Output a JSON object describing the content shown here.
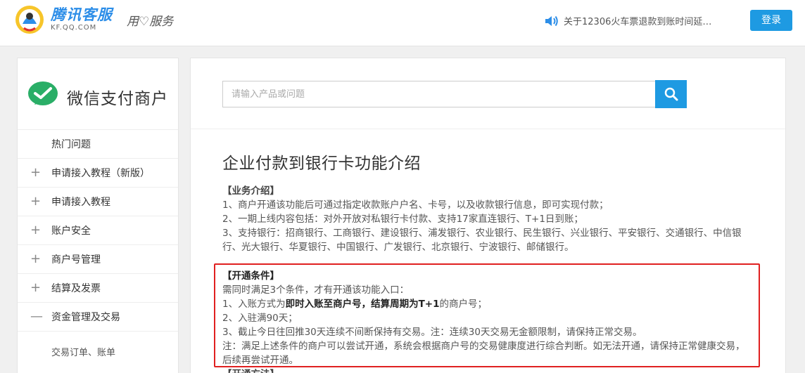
{
  "header": {
    "brand_cn": "腾讯客服",
    "brand_url": "KF.QQ.COM",
    "slogan": "用♡服务",
    "notice": "关于12306火车票退款到账时间延…",
    "login_label": "登录"
  },
  "sidebar": {
    "title": "微信支付商户",
    "items": [
      {
        "label": "热门问题",
        "icon": ""
      },
      {
        "label": "申请接入教程（新版）",
        "icon": "+"
      },
      {
        "label": "申请接入教程",
        "icon": "+"
      },
      {
        "label": "账户安全",
        "icon": "+"
      },
      {
        "label": "商户号管理",
        "icon": "+"
      },
      {
        "label": "结算及发票",
        "icon": "+"
      },
      {
        "label": "资金管理及交易",
        "icon": "—"
      }
    ],
    "sub_items": [
      "交易订单、账单"
    ]
  },
  "search": {
    "placeholder": "请输入产品或问题"
  },
  "article": {
    "title": "企业付款到银行卡功能介绍",
    "s1_heading": "【业务介绍】",
    "s1_lines": [
      "1、商户开通该功能后可通过指定收款账户户名、卡号，以及收款银行信息，即可实现付款；",
      "2、一期上线内容包括：对外开放对私银行卡付款、支持17家直连银行、T+1日到账；",
      "3、支持银行：招商银行、工商银行、建设银行、浦发银行、农业银行、民生银行、兴业银行、平安银行、交通银行、中信银行、光大银行、华夏银行、中国银行、广发银行、北京银行、宁波银行、邮储银行。"
    ],
    "s2_heading": "【开通条件】",
    "s2_intro": "需同时满足3个条件，才有开通该功能入口：",
    "s2_l1_pre": "1、入账方式为",
    "s2_l1_bold1": "即时入账至商户号，结算周期为T+1",
    "s2_l1_post": "的商户号；",
    "s2_l2": "2、入驻满90天；",
    "s2_l3": "3、截止今日往回推30天连续不间断保持有交易。注：连续30天交易无金额限制，请保持正常交易。",
    "s2_note": "注：满足上述条件的商户可以尝试开通，系统会根据商户号的交易健康度进行综合判断。如无法开通，请保持正常健康交易，后续再尝试开通。",
    "s3_heading": "【开通方法】"
  },
  "colors": {
    "accent": "#1e9ae2",
    "highlight_border": "#e02020",
    "wechat_green": "#2aae67"
  }
}
